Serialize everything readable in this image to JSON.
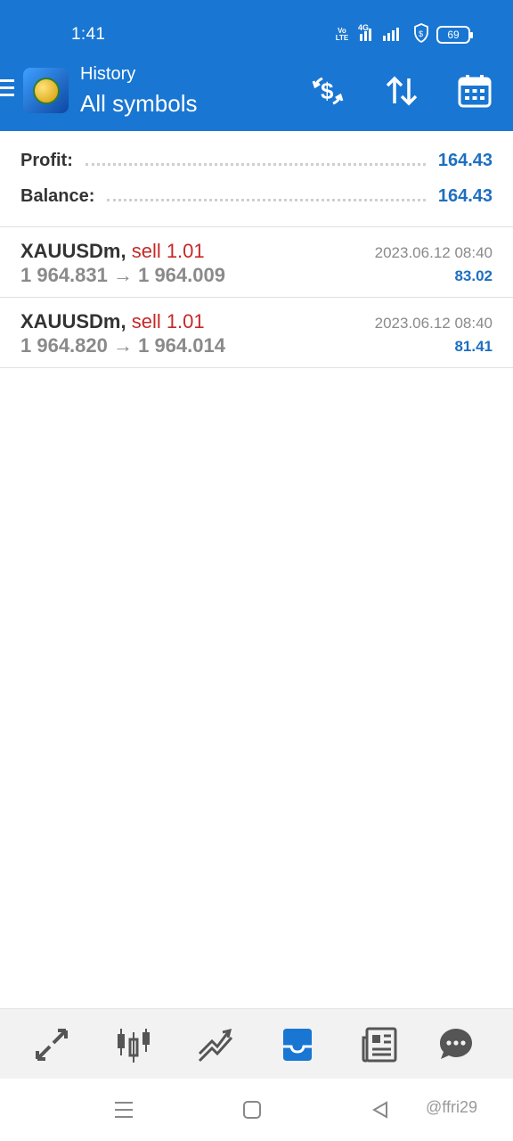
{
  "status_bar": {
    "time": "1:41",
    "volte": "Vo LTE",
    "network": "4G",
    "battery": "69"
  },
  "header": {
    "subtitle": "History",
    "title": "All symbols",
    "icons": [
      "menu-icon",
      "app-logo",
      "dollar-refresh-icon",
      "sort-icon",
      "calendar-icon"
    ]
  },
  "summary": {
    "profit_label": "Profit:",
    "profit_value": "164.43",
    "balance_label": "Balance:",
    "balance_value": "164.43"
  },
  "deals": [
    {
      "symbol": "XAUUSDm,",
      "type": "sell 1.01",
      "prices": "1 964.831 → 1 964.009",
      "time": "2023.06.12 08:40",
      "profit": "83.02"
    },
    {
      "symbol": "XAUUSDm,",
      "type": "sell 1.01",
      "prices": "1 964.820 → 1 964.014",
      "time": "2023.06.12 08:40",
      "profit": "81.41"
    }
  ],
  "bottom_nav": [
    "quotes-icon",
    "chart-icon",
    "trade-icon",
    "history-icon",
    "news-icon",
    "chat-icon"
  ],
  "system_nav": [
    "recents-icon",
    "home-icon",
    "back-icon"
  ],
  "watermark": "@ffri29",
  "colors": {
    "header_bg": "#1976D2",
    "accent_blue": "#1e6fc0",
    "sell_red": "#c62828",
    "active_nav": "#1976D2"
  }
}
